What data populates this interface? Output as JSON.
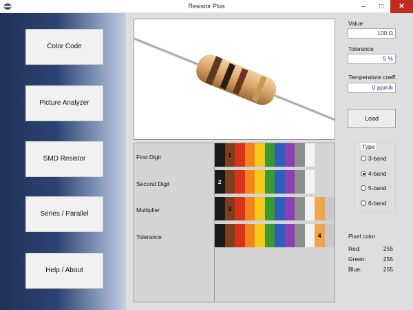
{
  "window": {
    "title": "Resistor Plus",
    "minimize": "–",
    "maximize": "□",
    "close": "✕"
  },
  "nav": [
    "Color Code",
    "Picture Analyzer",
    "SMD Resistor",
    "Series / Parallel",
    "Help / About"
  ],
  "value": {
    "label": "Value",
    "text": "100 Ω"
  },
  "tolerance": {
    "label": "Tolerance",
    "text": "5 %"
  },
  "temperature": {
    "label": "Temperature coeff.",
    "text": "0 ppm/k"
  },
  "load_label": "Load",
  "type": {
    "label": "Type",
    "options": [
      "3-band",
      "4-band",
      "5-band",
      "6-band"
    ],
    "selected": "4-band"
  },
  "pixel": {
    "title": "Pixel color",
    "red_label": "Red:",
    "red": "255",
    "green_label": "Green:",
    "green": "255",
    "blue_label": "Blue:",
    "blue": "255"
  },
  "bands": {
    "rows": [
      {
        "label": "First Digit",
        "colors": [
          "#1a1a1a",
          "#7b3f1d",
          "#d8321a",
          "#f2821c",
          "#f8c71a",
          "#3c9a2f",
          "#2f5fbd",
          "#8a3fb5",
          "#8e8e8e",
          "#f3f3f3"
        ],
        "marker": "1",
        "marker_index": 1
      },
      {
        "label": "Second Digit",
        "colors": [
          "#1a1a1a",
          "#7b3f1d",
          "#d8321a",
          "#f2821c",
          "#f8c71a",
          "#3c9a2f",
          "#2f5fbd",
          "#8a3fb5",
          "#8e8e8e",
          "#f3f3f3"
        ],
        "marker": "2",
        "marker_index": 0
      },
      {
        "label": "Multiplier",
        "colors": [
          "#1a1a1a",
          "#7b3f1d",
          "#d8321a",
          "#f2821c",
          "#f8c71a",
          "#3c9a2f",
          "#2f5fbd",
          "#8a3fb5",
          "#8e8e8e",
          "#f3f3f3",
          "#f0a64a",
          "#c9c9c9"
        ],
        "marker": "3",
        "marker_index": 1
      },
      {
        "label": "Tolerance",
        "colors": [
          "#1a1a1a",
          "#7b3f1d",
          "#d8321a",
          "#f2821c",
          "#f8c71a",
          "#3c9a2f",
          "#2f5fbd",
          "#8a3fb5",
          "#8e8e8e",
          "#f3f3f3",
          "#f0a64a",
          "#c9c9c9"
        ],
        "marker": "4",
        "marker_index": 10
      }
    ]
  },
  "icons": {
    "app": "resistor-app-icon"
  }
}
